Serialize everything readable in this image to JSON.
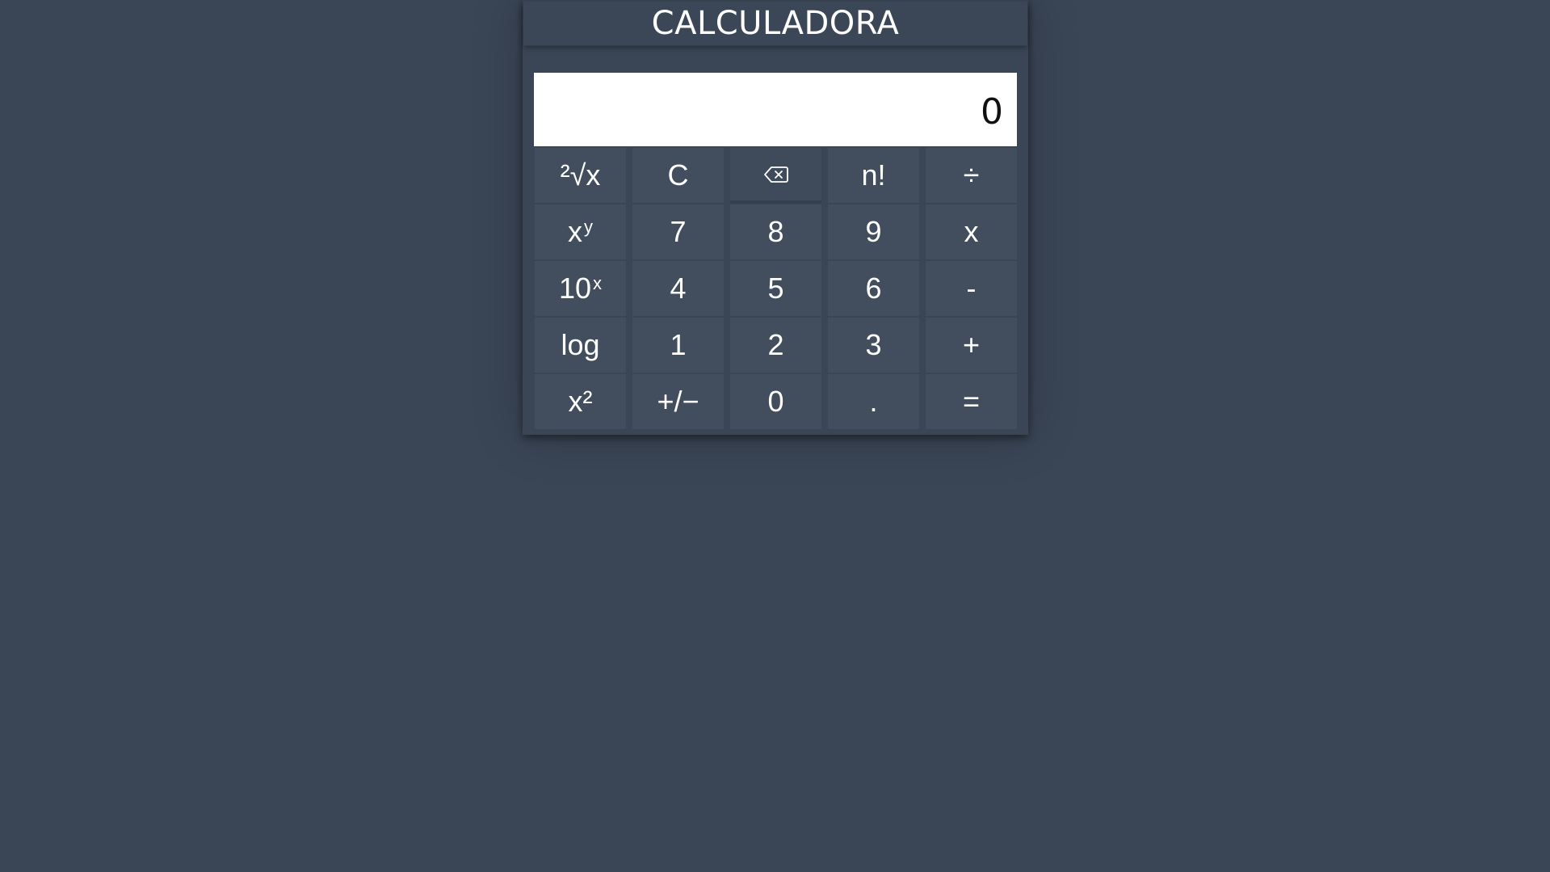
{
  "app": {
    "title": "CALCULADORA"
  },
  "display": {
    "value": "0"
  },
  "keys": {
    "root": {
      "base": "²√x"
    },
    "clear": "C",
    "backspace_icon": "backspace-icon",
    "factorial": "n!",
    "divide": "÷",
    "power": {
      "base": "x",
      "exp": "y"
    },
    "seven": "7",
    "eight": "8",
    "nine": "9",
    "multiply": "x",
    "ten_power": {
      "base": "10",
      "exp": "x"
    },
    "four": "4",
    "five": "5",
    "six": "6",
    "subtract": "-",
    "log": "log",
    "one": "1",
    "two": "2",
    "three": "3",
    "add": "+",
    "square": "x²",
    "negate": "+/−",
    "zero": "0",
    "decimal": ".",
    "equals": "="
  },
  "colors": {
    "background": "#3a4555",
    "key": "#424d5e",
    "display": "#ffffff",
    "text": "#ffffff"
  }
}
